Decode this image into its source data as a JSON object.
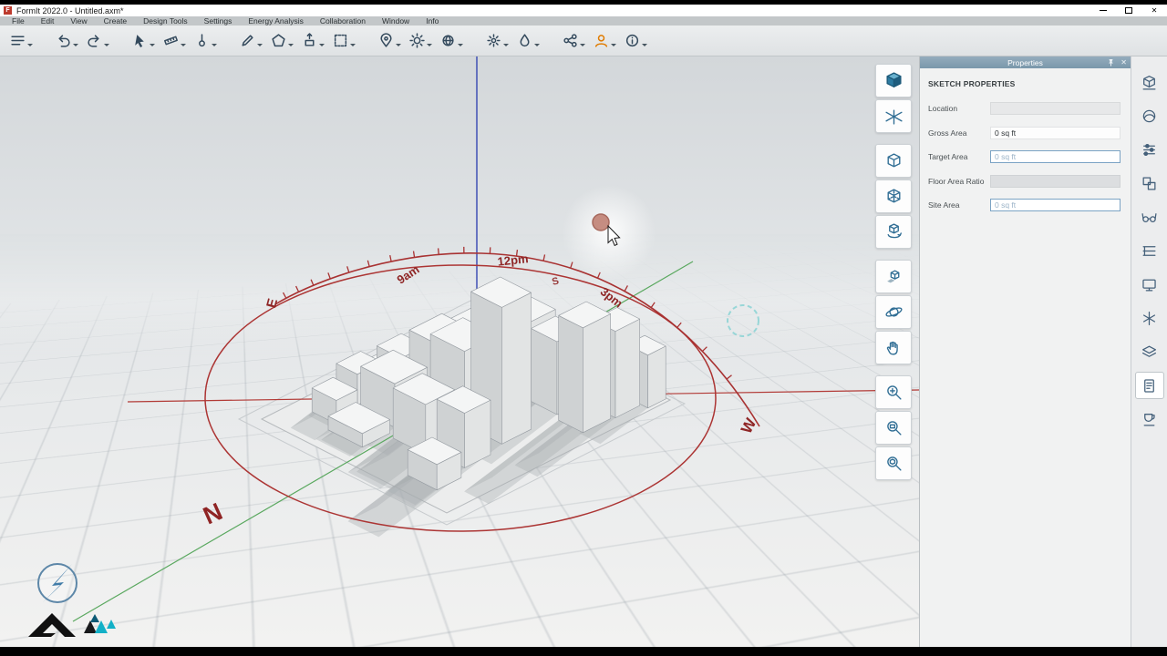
{
  "window": {
    "title": "FormIt 2022.0 - Untitled.axm*",
    "app_icon_letter": "F"
  },
  "menu_bar": {
    "items": [
      "File",
      "Edit",
      "View",
      "Create",
      "Design Tools",
      "Settings",
      "Energy Analysis",
      "Collaboration",
      "Window",
      "Info"
    ]
  },
  "toolbar": {
    "tools": [
      "main-menu",
      "undo",
      "redo",
      "select",
      "measure",
      "level",
      "draw",
      "shapes",
      "extrude",
      "marquee-select",
      "location-pin",
      "sun",
      "shadow-study",
      "settings",
      "material",
      "share",
      "account",
      "info"
    ]
  },
  "viewport": {
    "sun_path": {
      "labels": [
        "9am",
        "12pm",
        "3pm"
      ]
    },
    "compass": {
      "north": "N",
      "south": "S",
      "east": "E",
      "west": "W"
    },
    "colors": {
      "sun_path": "#a83232",
      "axis_x": "#b23a36",
      "axis_y": "#5aa85f",
      "axis_z": "#4050b5",
      "sun_marker": "#c08174",
      "building_top": "#f4f5f5",
      "building_left": "#cfd2d3",
      "building_right": "#e2e4e4"
    }
  },
  "nav_toolbar": {
    "buttons": [
      "view-cube",
      "sketch-grid",
      "box-xray",
      "box-solid",
      "box-rotate",
      "cube-shadow",
      "orbit",
      "pan",
      "zoom-in",
      "zoom-window",
      "zoom-extents"
    ]
  },
  "right_strip": {
    "icons": [
      "content-library",
      "materials",
      "adjustments",
      "groups",
      "visibility",
      "levels",
      "scenes",
      "sun-settings",
      "layers",
      "notes",
      "plugins"
    ],
    "active": "notes"
  },
  "properties_panel": {
    "title": "Properties",
    "section": "SKETCH PROPERTIES",
    "fields": [
      {
        "label": "Location",
        "value": ""
      },
      {
        "label": "Gross Area",
        "value": "0 sq ft"
      },
      {
        "label": "Target Area",
        "value": "0 sq ft"
      },
      {
        "label": "Floor Area Ratio",
        "value": ""
      },
      {
        "label": "Site Area",
        "value": "0 sq ft"
      }
    ]
  }
}
